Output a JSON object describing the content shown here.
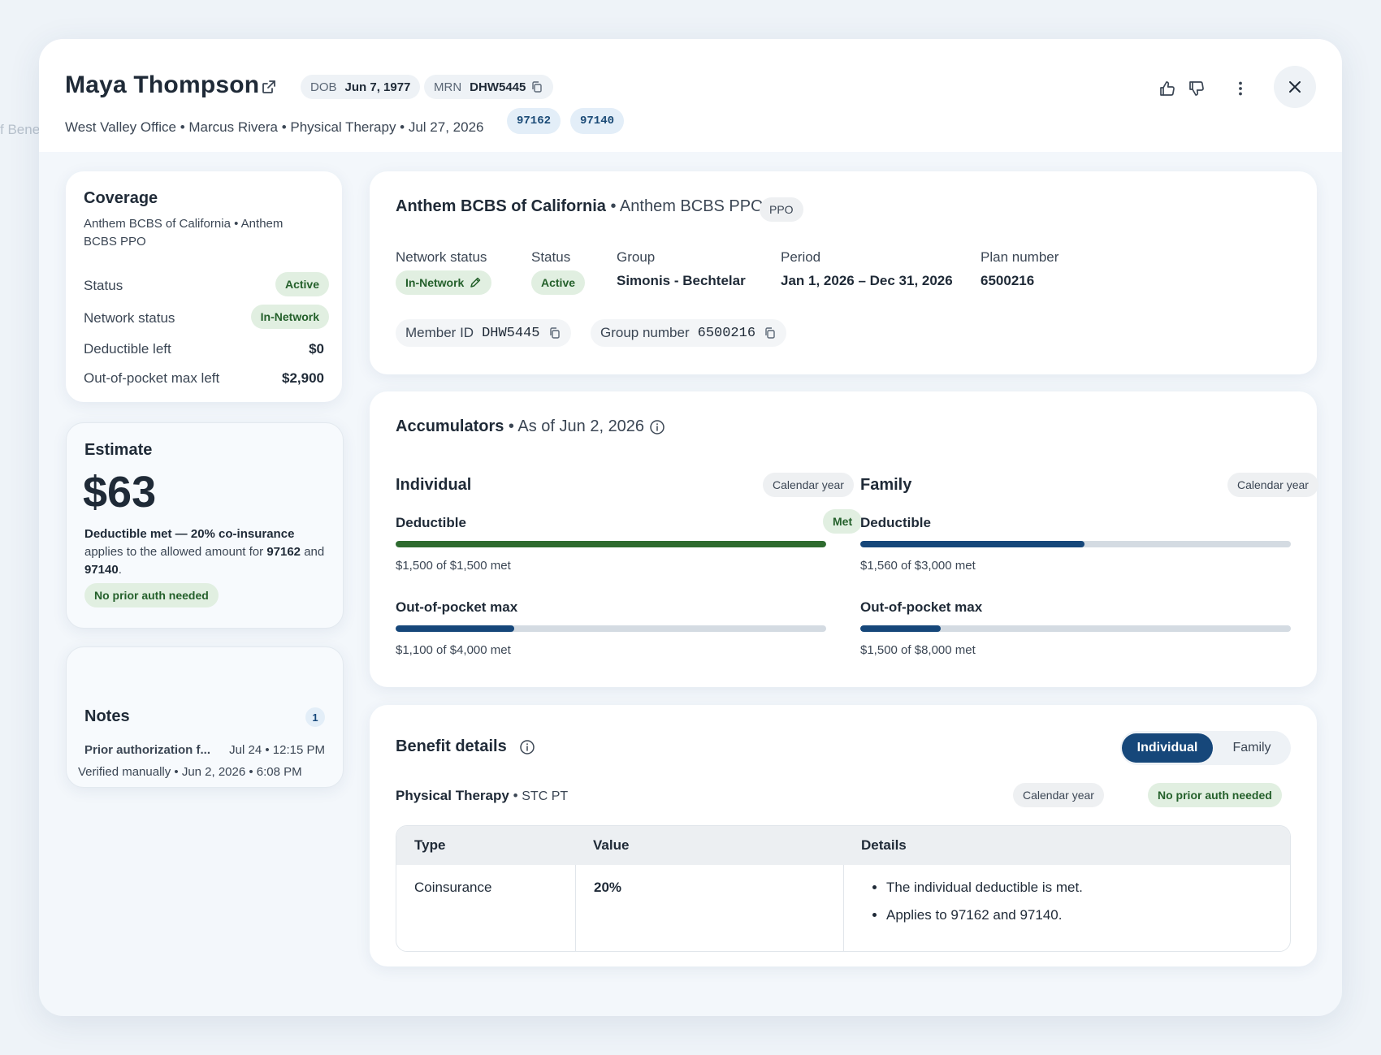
{
  "background_peek_text": "f Bene",
  "header": {
    "patient_name": "Maya Thompson",
    "dob_label": "DOB",
    "dob_value": "Jun 7, 1977",
    "mrn_label": "MRN",
    "mrn_value": "DHW5445",
    "subline": "West Valley Office • Marcus Rivera • Physical Therapy • Jul 27, 2026",
    "codes": [
      "97162",
      "97140"
    ]
  },
  "coverage_card": {
    "title": "Coverage",
    "subtitle": "Anthem BCBS of California • Anthem BCBS PPO",
    "status_label": "Status",
    "status_value": "Active",
    "network_label": "Network status",
    "network_value": "In-Network",
    "deductible_label": "Deductible left",
    "deductible_value": "$0",
    "oop_label": "Out-of-pocket max left",
    "oop_value": "$2,900"
  },
  "estimate_card": {
    "title": "Estimate",
    "amount": "$63",
    "desc_bold": "Deductible met — 20% co-insurance",
    "desc_text1": " applies to the allowed amount for ",
    "code1": "97162",
    "desc_and": " and ",
    "code2": "97140",
    "desc_end": ".",
    "badge": "No prior auth needed"
  },
  "notes_card": {
    "title": "Notes",
    "count": "1",
    "note_title": "Prior authorization f...",
    "note_time": "Jul 24 • 12:15 PM"
  },
  "verified_text": "Verified manually • Jun 2, 2026 • 6:08 PM",
  "plan_card": {
    "payer": "Anthem BCBS of California",
    "separator": " • ",
    "plan_name": "Anthem BCBS PPO",
    "plan_type": "PPO",
    "network_status_label": "Network status",
    "network_status_value": "In-Network",
    "status_label": "Status",
    "status_value": "Active",
    "group_label": "Group",
    "group_value": "Simonis - Bechtelar",
    "period_label": "Period",
    "period_value": "Jan 1, 2026 – Dec 31, 2026",
    "plan_number_label": "Plan number",
    "plan_number_value": "6500216",
    "member_id_label": "Member ID",
    "member_id_value": "DHW5445",
    "group_number_label": "Group number",
    "group_number_value": "6500216"
  },
  "accumulators": {
    "title": "Accumulators",
    "as_of": "As of Jun 2, 2026",
    "individual": {
      "title": "Individual",
      "period": "Calendar year",
      "deductible_label": "Deductible",
      "deductible_badge": "Met",
      "deductible_fraction": 1.0,
      "deductible_text": "$1,500 of $1,500 met",
      "oop_label": "Out-of-pocket max",
      "oop_fraction": 0.275,
      "oop_text": "$1,100 of $4,000 met"
    },
    "family": {
      "title": "Family",
      "period": "Calendar year",
      "deductible_label": "Deductible",
      "deductible_fraction": 0.52,
      "deductible_text": "$1,560 of $3,000 met",
      "oop_label": "Out-of-pocket max",
      "oop_fraction": 0.1875,
      "oop_text": "$1,500 of $8,000 met"
    },
    "colors": {
      "met": "#2e6b2f",
      "progress": "#16477a",
      "track": "#d4dbe2"
    }
  },
  "benefit_details": {
    "title": "Benefit details",
    "toggle": [
      "Individual",
      "Family"
    ],
    "service": "Physical Therapy",
    "service_code": "STC PT",
    "period": "Calendar year",
    "auth": "No prior auth needed",
    "columns": [
      "Type",
      "Value",
      "Details"
    ],
    "rows": [
      {
        "type": "Coinsurance",
        "value": "20%",
        "details": [
          "The individual deductible is met.",
          "Applies to 97162 and 97140."
        ]
      }
    ]
  }
}
